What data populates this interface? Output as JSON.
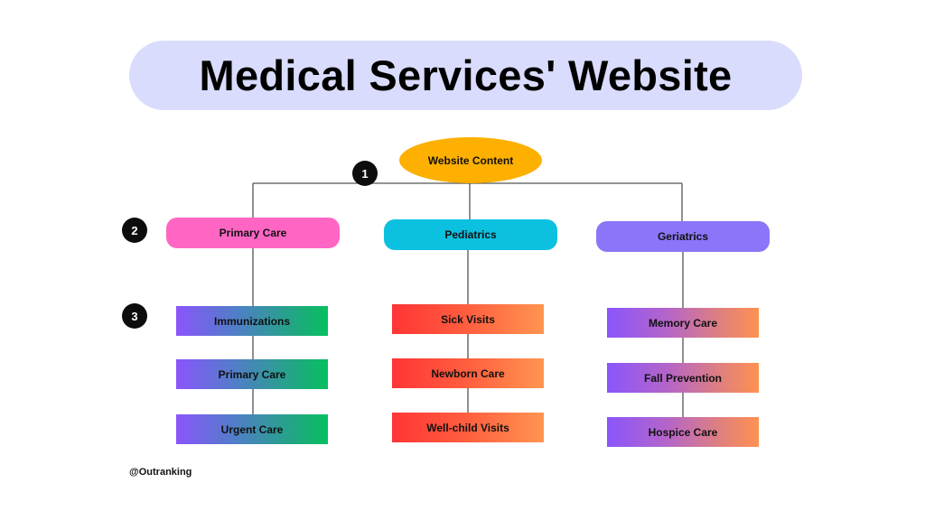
{
  "title": "Medical Services' Website",
  "root": {
    "label": "Website Content",
    "color": "#fdb000"
  },
  "level_badges": [
    "1",
    "2",
    "3"
  ],
  "categories": [
    {
      "label": "Primary Care",
      "color": "#ff66c4",
      "children": [
        "Immunizations",
        "Primary Care",
        "Urgent Care"
      ]
    },
    {
      "label": "Pediatrics",
      "color": "#0cc0df",
      "children": [
        "Sick Visits",
        "Newborn Care",
        "Well-child Visits"
      ]
    },
    {
      "label": "Geriatrics",
      "color": "#8c75f8",
      "children": [
        "Memory Care",
        "Fall Prevention",
        "Hospice Care"
      ]
    }
  ],
  "credit": "@Outranking",
  "colors": {
    "title_background": "#d9dcfc",
    "connector": "#555555",
    "badge": "#0d0d0d"
  }
}
